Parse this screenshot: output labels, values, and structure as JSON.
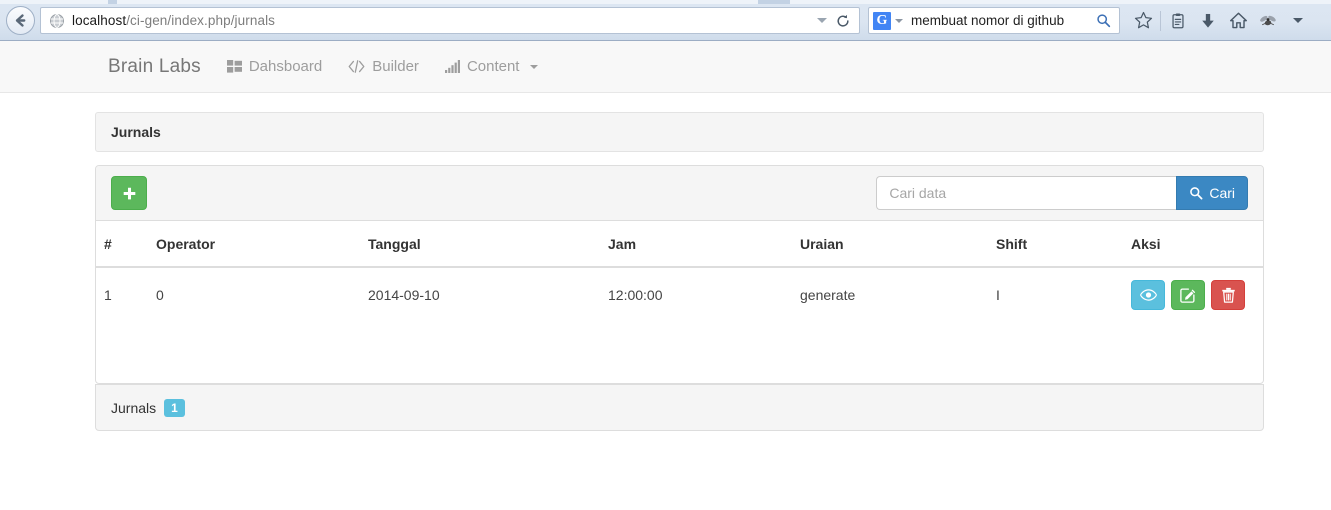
{
  "browser": {
    "back_icon": "back-arrow-icon",
    "url": {
      "host": "localhost",
      "path": "/ci-gen/index.php/jurnals",
      "identity_icon": "globe-icon",
      "dropdown_icon": "chevron-down-icon",
      "reload_icon": "reload-icon"
    },
    "search": {
      "engine_letter": "G",
      "engine_caret_icon": "chevron-down-icon",
      "value": "membuat nomor di github",
      "go_icon": "magnifier-icon"
    },
    "toolbar_icons": [
      {
        "name": "bookmark-star-icon"
      },
      {
        "name": "reading-list-icon"
      },
      {
        "name": "downloads-icon"
      },
      {
        "name": "home-icon"
      },
      {
        "name": "extension-fly-icon"
      },
      {
        "name": "overflow-chevron-down-icon"
      }
    ]
  },
  "navbar": {
    "brand": "Brain Labs",
    "items": [
      {
        "label": "Dahsboard",
        "icon": "th-large-icon",
        "has_caret": false
      },
      {
        "label": "Builder",
        "icon": "code-icon",
        "has_caret": false
      },
      {
        "label": "Content",
        "icon": "signal-bars-icon",
        "has_caret": true
      }
    ]
  },
  "page": {
    "title": "Jurnals"
  },
  "toolbar": {
    "add_label": "+",
    "add_icon": "plus-icon",
    "search_placeholder": "Cari data",
    "search_value": "",
    "search_button_label": "Cari",
    "search_button_icon": "magnifier-icon"
  },
  "table": {
    "columns": [
      "#",
      "Operator",
      "Tanggal",
      "Jam",
      "Uraian",
      "Shift",
      "Aksi"
    ],
    "rows": [
      {
        "num": "1",
        "operator": "0",
        "tanggal": "2014-09-10",
        "jam": "12:00:00",
        "uraian": "generate",
        "shift": "I",
        "actions": [
          {
            "name": "view-button",
            "icon": "eye-icon"
          },
          {
            "name": "edit-button",
            "icon": "pencil-square-icon"
          },
          {
            "name": "delete-button",
            "icon": "trash-icon"
          }
        ]
      }
    ]
  },
  "footer": {
    "label": "Jurnals",
    "count": "1"
  },
  "colors": {
    "brand_green": "#5cb85c",
    "primary_blue": "#3b88c3",
    "info_blue": "#5bc0de",
    "danger_red": "#d9534f",
    "panel_gray": "#f5f5f5",
    "border_gray": "#dddddd",
    "nav_bg": "#f8f8f8",
    "nav_text": "#9d9d9d",
    "chrome_blue": "#dce6f2"
  }
}
